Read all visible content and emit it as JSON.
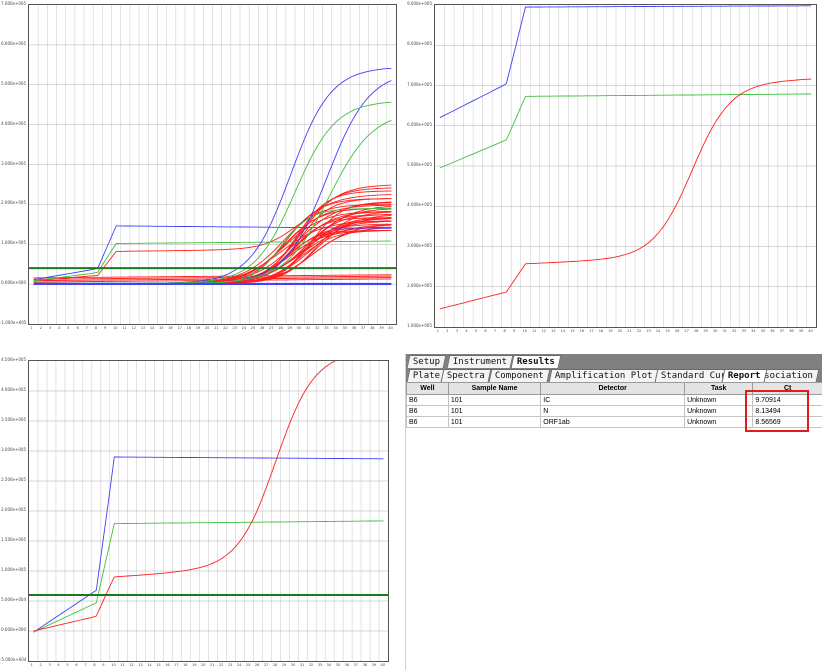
{
  "plots": {
    "top_left": {
      "y_ticks": [
        "7.000e+005",
        "6.000e+005",
        "5.000e+005",
        "4.000e+005",
        "3.000e+005",
        "2.000e+005",
        "1.000e+005",
        "0.000e+000",
        "-1.000e+005"
      ],
      "x_ticks": [
        "1",
        "2",
        "3",
        "4",
        "5",
        "6",
        "7",
        "8",
        "9",
        "10",
        "11",
        "12",
        "13",
        "14",
        "15",
        "16",
        "17",
        "18",
        "19",
        "20",
        "21",
        "22",
        "23",
        "24",
        "25",
        "26",
        "27",
        "28",
        "29",
        "30",
        "31",
        "32",
        "33",
        "34",
        "35",
        "36",
        "37",
        "38",
        "39",
        "40"
      ]
    },
    "top_right": {
      "y_ticks": [
        "9.000e+005",
        "8.000e+005",
        "7.000e+005",
        "6.000e+005",
        "5.000e+005",
        "4.000e+005",
        "3.000e+005",
        "2.000e+005",
        "1.000e+005"
      ],
      "x_ticks": [
        "1",
        "2",
        "3",
        "4",
        "5",
        "6",
        "7",
        "8",
        "9",
        "10",
        "11",
        "12",
        "13",
        "14",
        "15",
        "16",
        "17",
        "18",
        "19",
        "20",
        "21",
        "22",
        "23",
        "24",
        "25",
        "26",
        "27",
        "28",
        "29",
        "30",
        "31",
        "32",
        "33",
        "34",
        "35",
        "36",
        "37",
        "38",
        "39",
        "40"
      ]
    },
    "bottom_left": {
      "y_ticks": [
        "4.500e+005",
        "4.000e+005",
        "3.500e+005",
        "3.000e+005",
        "2.500e+005",
        "2.000e+005",
        "1.500e+005",
        "1.000e+005",
        "5.000e+004",
        "0.000e+000",
        "-5.000e+004"
      ],
      "x_ticks": [
        "1",
        "2",
        "3",
        "4",
        "5",
        "6",
        "7",
        "8",
        "9",
        "10",
        "11",
        "12",
        "13",
        "14",
        "15",
        "16",
        "17",
        "18",
        "19",
        "20",
        "21",
        "22",
        "23",
        "24",
        "25",
        "26",
        "27",
        "28",
        "29",
        "30",
        "31",
        "32",
        "33",
        "34",
        "35",
        "36",
        "37",
        "38",
        "39",
        "40"
      ]
    }
  },
  "colors": {
    "ic": "#4040ff",
    "n": "#40c040",
    "orf": "#ff2020",
    "threshold": "#1a7a1a"
  },
  "tabs_top": [
    "Setup",
    "Instrument",
    "Results"
  ],
  "tabs_sub": [
    "Plate",
    "Spectra",
    "Component",
    "Amplification Plot",
    "Standard Curve",
    "Dissociation",
    "Report"
  ],
  "report": {
    "headers": [
      "Well",
      "Sample Name",
      "Detector",
      "Task",
      "Ct"
    ],
    "rows": [
      {
        "well": "B6",
        "sample": "101",
        "detector": "IC",
        "task": "Unknown",
        "ct": "9.70914"
      },
      {
        "well": "B6",
        "sample": "101",
        "detector": "N",
        "task": "Unknown",
        "ct": "8.13494"
      },
      {
        "well": "B6",
        "sample": "101",
        "detector": "ORF1ab",
        "task": "Unknown",
        "ct": "8.56569"
      }
    ]
  }
}
